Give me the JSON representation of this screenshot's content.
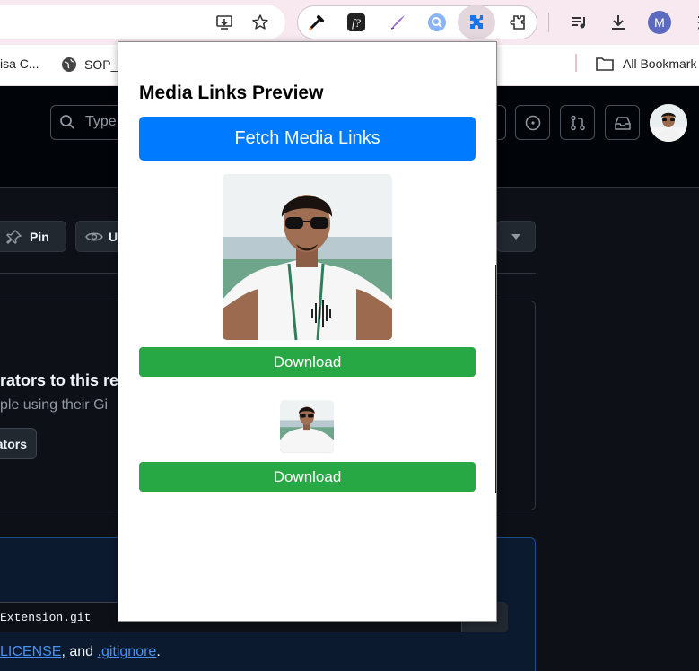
{
  "browser": {
    "bookmarks": [
      {
        "label": "isa C...",
        "icon": "bookmark-icon"
      },
      {
        "label": "SOP_",
        "icon": "globe-icon"
      },
      {
        "label": "All Bookmark",
        "icon": "folder-icon"
      }
    ],
    "profile_initial": "M"
  },
  "github": {
    "search_placeholder": "Type",
    "pin_label": "Pin",
    "unwatch_label": "U",
    "panel_title": "rators to this re",
    "panel_subtitle": "ple using their Gi",
    "collab_button_label": "ators",
    "clone_url_text": "Extension.git",
    "bottom_link_license": "LICENSE",
    "bottom_text_and": ", and ",
    "bottom_link_gitignore": ".gitignore",
    "bottom_text_period": "."
  },
  "popup": {
    "title": "Media Links Preview",
    "fetch_button": "Fetch Media Links",
    "media": [
      {
        "download_label": "Download"
      },
      {
        "download_label": "Download"
      }
    ]
  },
  "colors": {
    "fetch_button": "#007bff",
    "download_button": "#28a745",
    "github_bg": "#0d1117",
    "link": "#4493f8"
  }
}
